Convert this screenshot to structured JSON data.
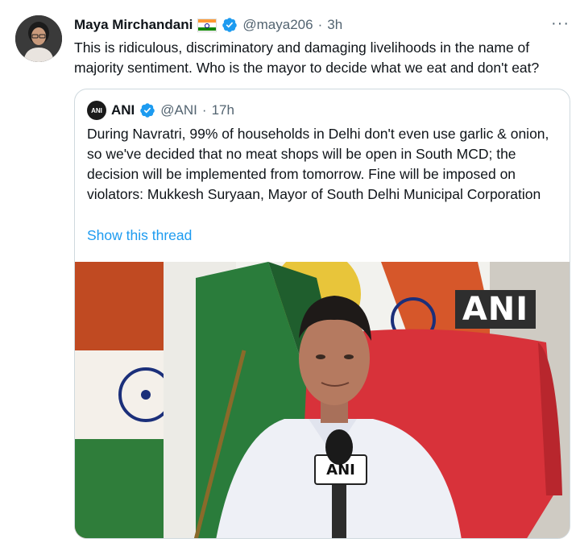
{
  "tweet": {
    "author_name": "Maya Mirchandani",
    "handle": "@maya206",
    "separator": "·",
    "time": "3h",
    "more": "···",
    "text": "This is ridiculous, discriminatory and damaging livelihoods in the name of majority sentiment. Who is the mayor to decide what we eat and don't eat?"
  },
  "quote": {
    "avatar_text": "ANI",
    "author_name": "ANI",
    "handle": "@ANI",
    "separator": "·",
    "time": "17h",
    "text": "During Navratri, 99% of households in Delhi don't even use garlic & onion, so we've decided that no meat shops will be open in South MCD; the decision will be implemented from tomorrow. Fine will be imposed on violators: Mukkesh Suryaan, Mayor of South Delhi Municipal Corporation",
    "show_thread": "Show this thread",
    "media": {
      "watermark": "ANI",
      "mic_label": "ANI"
    }
  },
  "colors": {
    "link": "#1d9bf0",
    "verified": "#1d9bf0",
    "secondary_text": "#536471",
    "border": "#cfd9de"
  }
}
